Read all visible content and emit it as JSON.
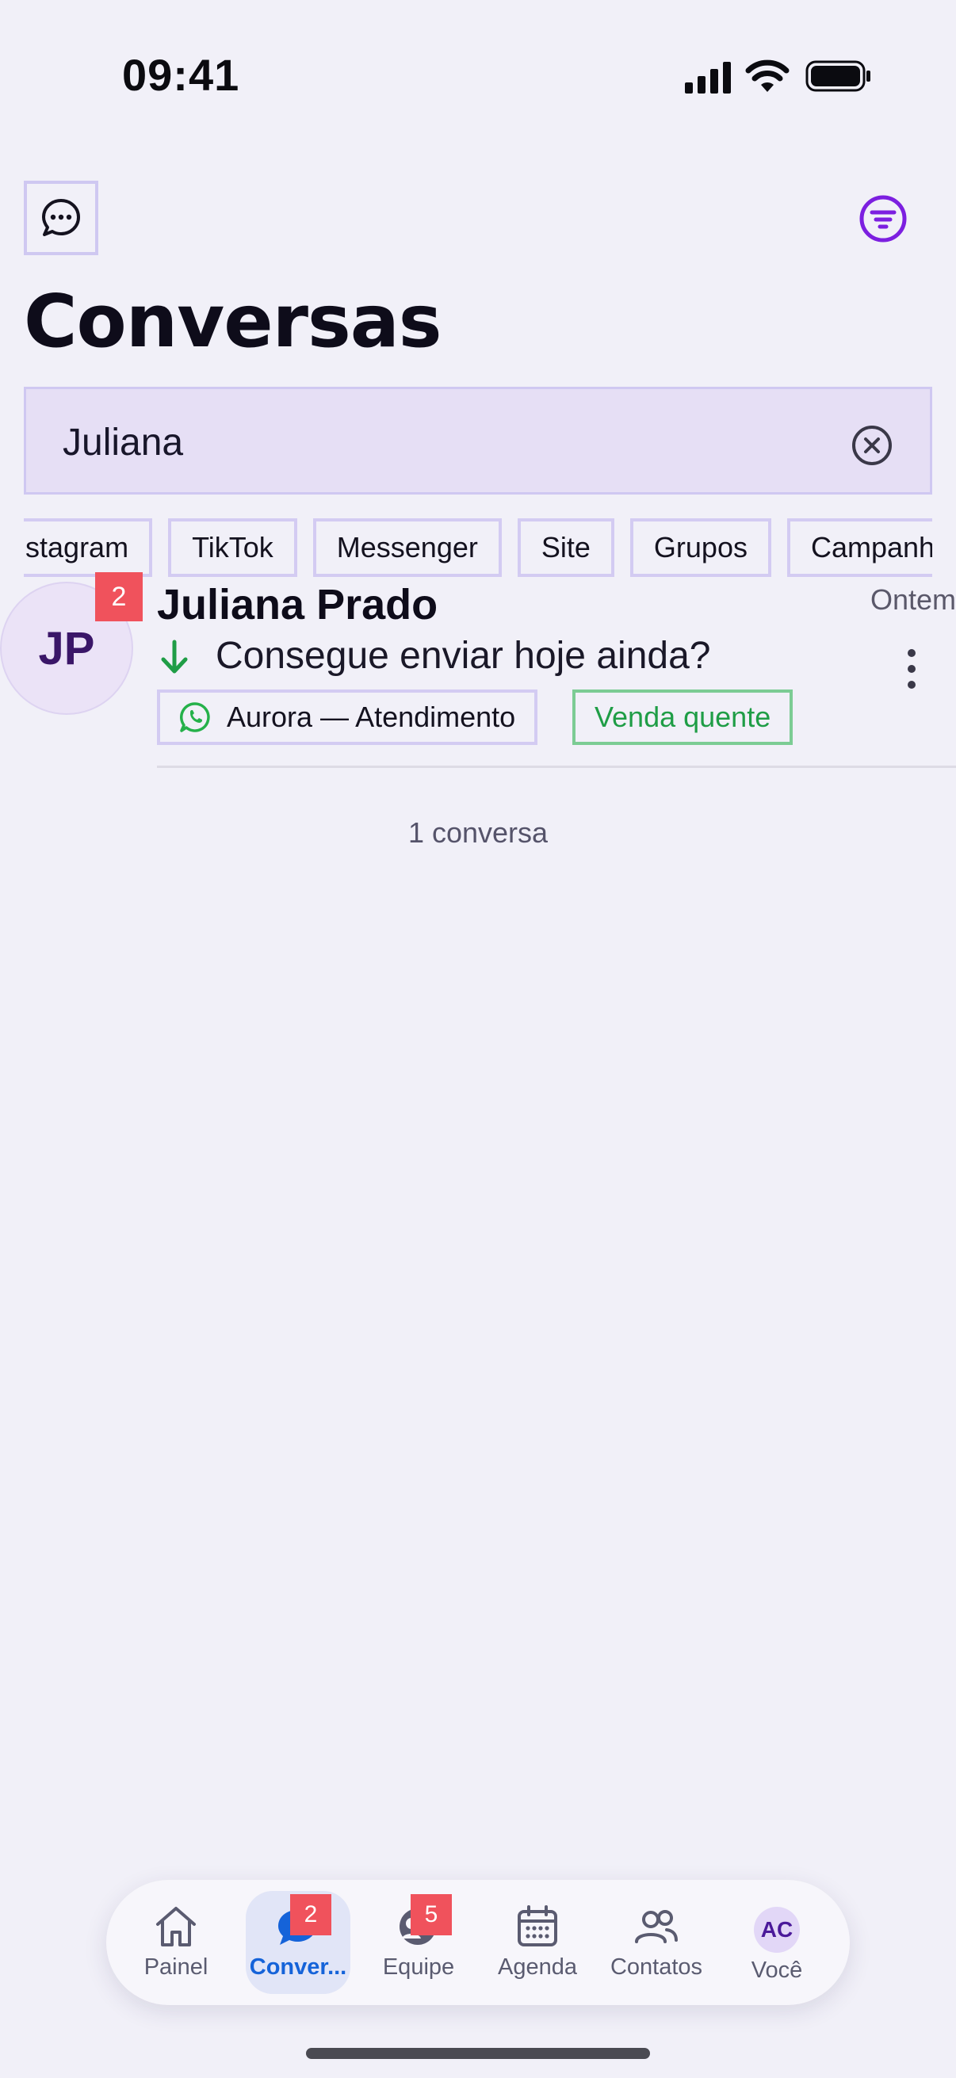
{
  "status_bar": {
    "time": "09:41"
  },
  "header": {
    "title": "Conversas",
    "compose_icon": "chat-bubble-icon",
    "filter_icon": "filter-icon"
  },
  "search": {
    "value": "Juliana"
  },
  "channel_chips": [
    "Instagram",
    "TikTok",
    "Messenger",
    "Site",
    "Grupos",
    "Campanhas"
  ],
  "conversations": [
    {
      "avatar_initials": "JP",
      "unread_count": "2",
      "name": "Juliana Prado",
      "time": "Ontem",
      "last_message": "Consegue enviar hoje ainda?",
      "direction": "incoming",
      "inbox": "Aurora — Atendimento",
      "inbox_channel_icon": "whatsapp-icon",
      "label": "Venda quente",
      "label_color": "#1f9d46"
    }
  ],
  "results_count": "1 conversa",
  "bottom_nav": {
    "items": [
      {
        "label": "Painel",
        "icon": "home-icon",
        "badge": ""
      },
      {
        "label": "Conver...",
        "icon": "chats-icon",
        "badge": "2",
        "active": true
      },
      {
        "label": "Equipe",
        "icon": "team-chat-icon",
        "badge": "5"
      },
      {
        "label": "Agenda",
        "icon": "calendar-icon",
        "badge": ""
      },
      {
        "label": "Contatos",
        "icon": "contacts-icon",
        "badge": ""
      },
      {
        "label": "Você",
        "icon": "profile-avatar",
        "avatar_initials": "AC",
        "badge": ""
      }
    ]
  },
  "colors": {
    "accent": "#7c1fe0",
    "active_nav": "#1563d9",
    "badge": "#f0525c",
    "background": "#f1f0f8"
  }
}
